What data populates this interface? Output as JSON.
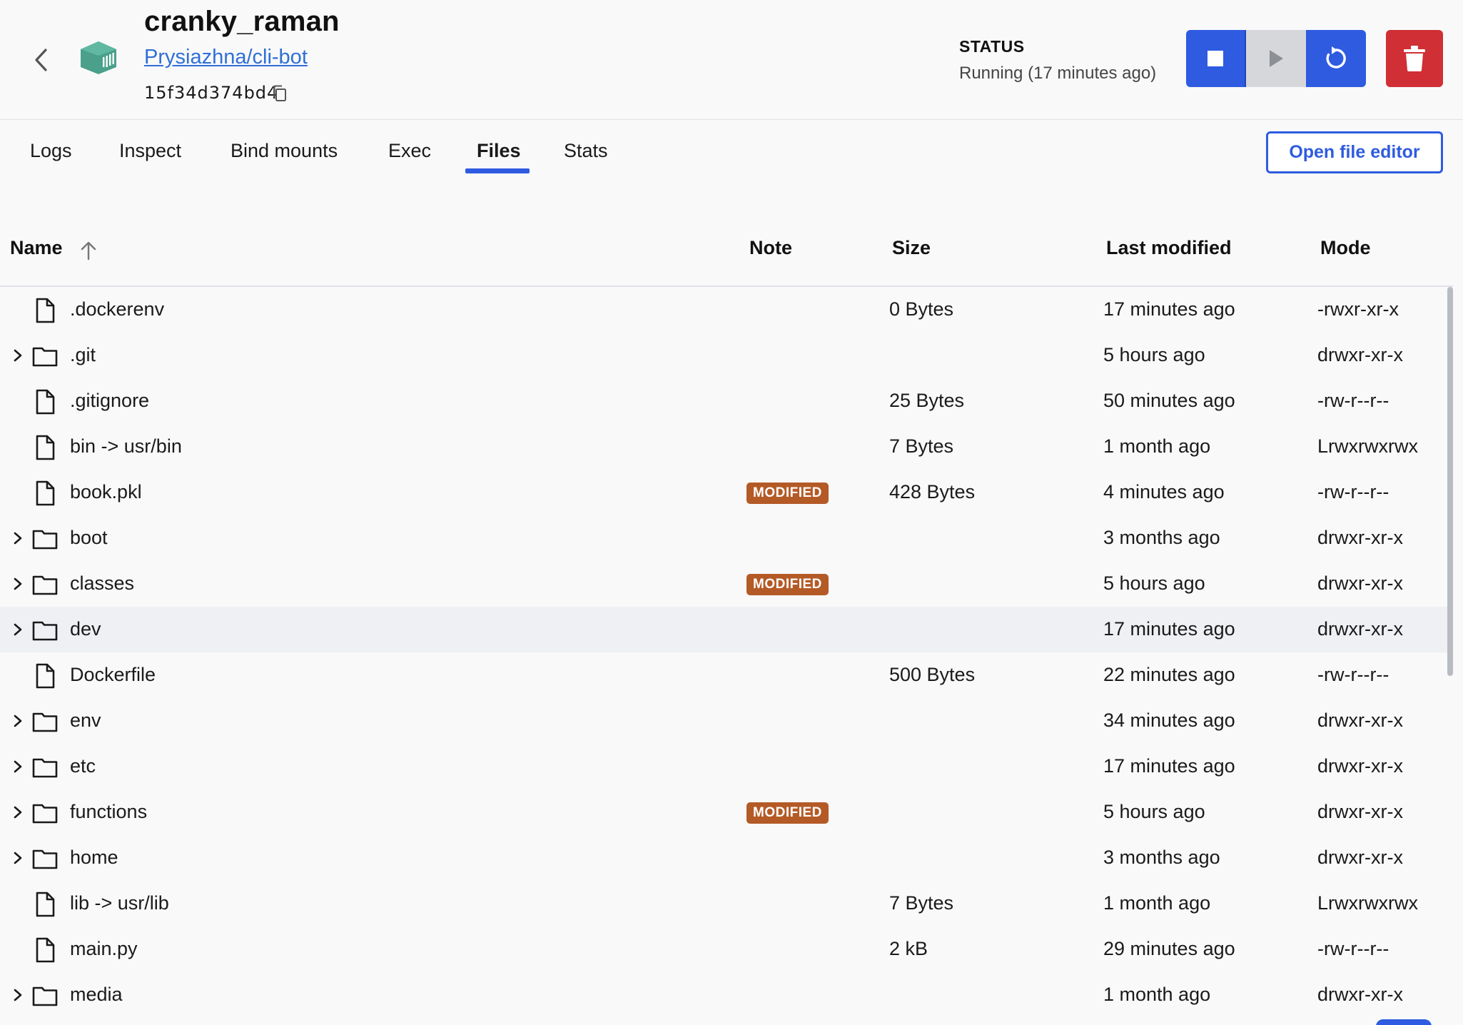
{
  "header": {
    "title": "cranky_raman",
    "image_link": "Prysiazhna/cli-bot",
    "short_id": "15f34d374bd4",
    "status_label": "STATUS",
    "status_value": "Running (17 minutes ago)",
    "icons": {
      "back": "chevron-left-icon",
      "logo": "container-icon",
      "copy": "copy-icon",
      "stop": "stop-icon",
      "start": "play-icon",
      "restart": "restart-icon",
      "delete": "trash-icon"
    },
    "colors": {
      "primary": "#2e5be0",
      "danger": "#cf2f35",
      "logo": "#4aa08a",
      "modified": "#b45a26"
    }
  },
  "tabs": [
    {
      "label": "Logs",
      "active": false
    },
    {
      "label": "Inspect",
      "active": false
    },
    {
      "label": "Bind mounts",
      "active": false
    },
    {
      "label": "Exec",
      "active": false
    },
    {
      "label": "Files",
      "active": true
    },
    {
      "label": "Stats",
      "active": false
    }
  ],
  "open_editor_label": "Open file editor",
  "table": {
    "columns": {
      "name": "Name",
      "note": "Note",
      "size": "Size",
      "modified": "Last modified",
      "mode": "Mode"
    },
    "sort": {
      "column": "Name",
      "direction": "ascending"
    },
    "rows": [
      {
        "type": "file",
        "name": ".dockerenv",
        "note": "",
        "size": "0 Bytes",
        "modified": "17 minutes ago",
        "mode": "-rwxr-xr-x"
      },
      {
        "type": "folder",
        "name": ".git",
        "note": "",
        "size": "",
        "modified": "5 hours ago",
        "mode": "drwxr-xr-x"
      },
      {
        "type": "file",
        "name": ".gitignore",
        "note": "",
        "size": "25 Bytes",
        "modified": "50 minutes ago",
        "mode": "-rw-r--r--"
      },
      {
        "type": "file",
        "name": "bin -> usr/bin",
        "note": "",
        "size": "7 Bytes",
        "modified": "1 month ago",
        "mode": "Lrwxrwxrwx"
      },
      {
        "type": "file",
        "name": "book.pkl",
        "note": "MODIFIED",
        "size": "428 Bytes",
        "modified": "4 minutes ago",
        "mode": "-rw-r--r--"
      },
      {
        "type": "folder",
        "name": "boot",
        "note": "",
        "size": "",
        "modified": "3 months ago",
        "mode": "drwxr-xr-x"
      },
      {
        "type": "folder",
        "name": "classes",
        "note": "MODIFIED",
        "size": "",
        "modified": "5 hours ago",
        "mode": "drwxr-xr-x"
      },
      {
        "type": "folder",
        "name": "dev",
        "note": "",
        "size": "",
        "modified": "17 minutes ago",
        "mode": "drwxr-xr-x",
        "hover": true
      },
      {
        "type": "file",
        "name": "Dockerfile",
        "note": "",
        "size": "500 Bytes",
        "modified": "22 minutes ago",
        "mode": "-rw-r--r--"
      },
      {
        "type": "folder",
        "name": "env",
        "note": "",
        "size": "",
        "modified": "34 minutes ago",
        "mode": "drwxr-xr-x"
      },
      {
        "type": "folder",
        "name": "etc",
        "note": "",
        "size": "",
        "modified": "17 minutes ago",
        "mode": "drwxr-xr-x"
      },
      {
        "type": "folder",
        "name": "functions",
        "note": "MODIFIED",
        "size": "",
        "modified": "5 hours ago",
        "mode": "drwxr-xr-x"
      },
      {
        "type": "folder",
        "name": "home",
        "note": "",
        "size": "",
        "modified": "3 months ago",
        "mode": "drwxr-xr-x"
      },
      {
        "type": "file",
        "name": "lib -> usr/lib",
        "note": "",
        "size": "7 Bytes",
        "modified": "1 month ago",
        "mode": "Lrwxrwxrwx"
      },
      {
        "type": "file",
        "name": "main.py",
        "note": "",
        "size": "2 kB",
        "modified": "29 minutes ago",
        "mode": "-rw-r--r--"
      },
      {
        "type": "folder",
        "name": "media",
        "note": "",
        "size": "",
        "modified": "1 month ago",
        "mode": "drwxr-xr-x"
      }
    ]
  }
}
